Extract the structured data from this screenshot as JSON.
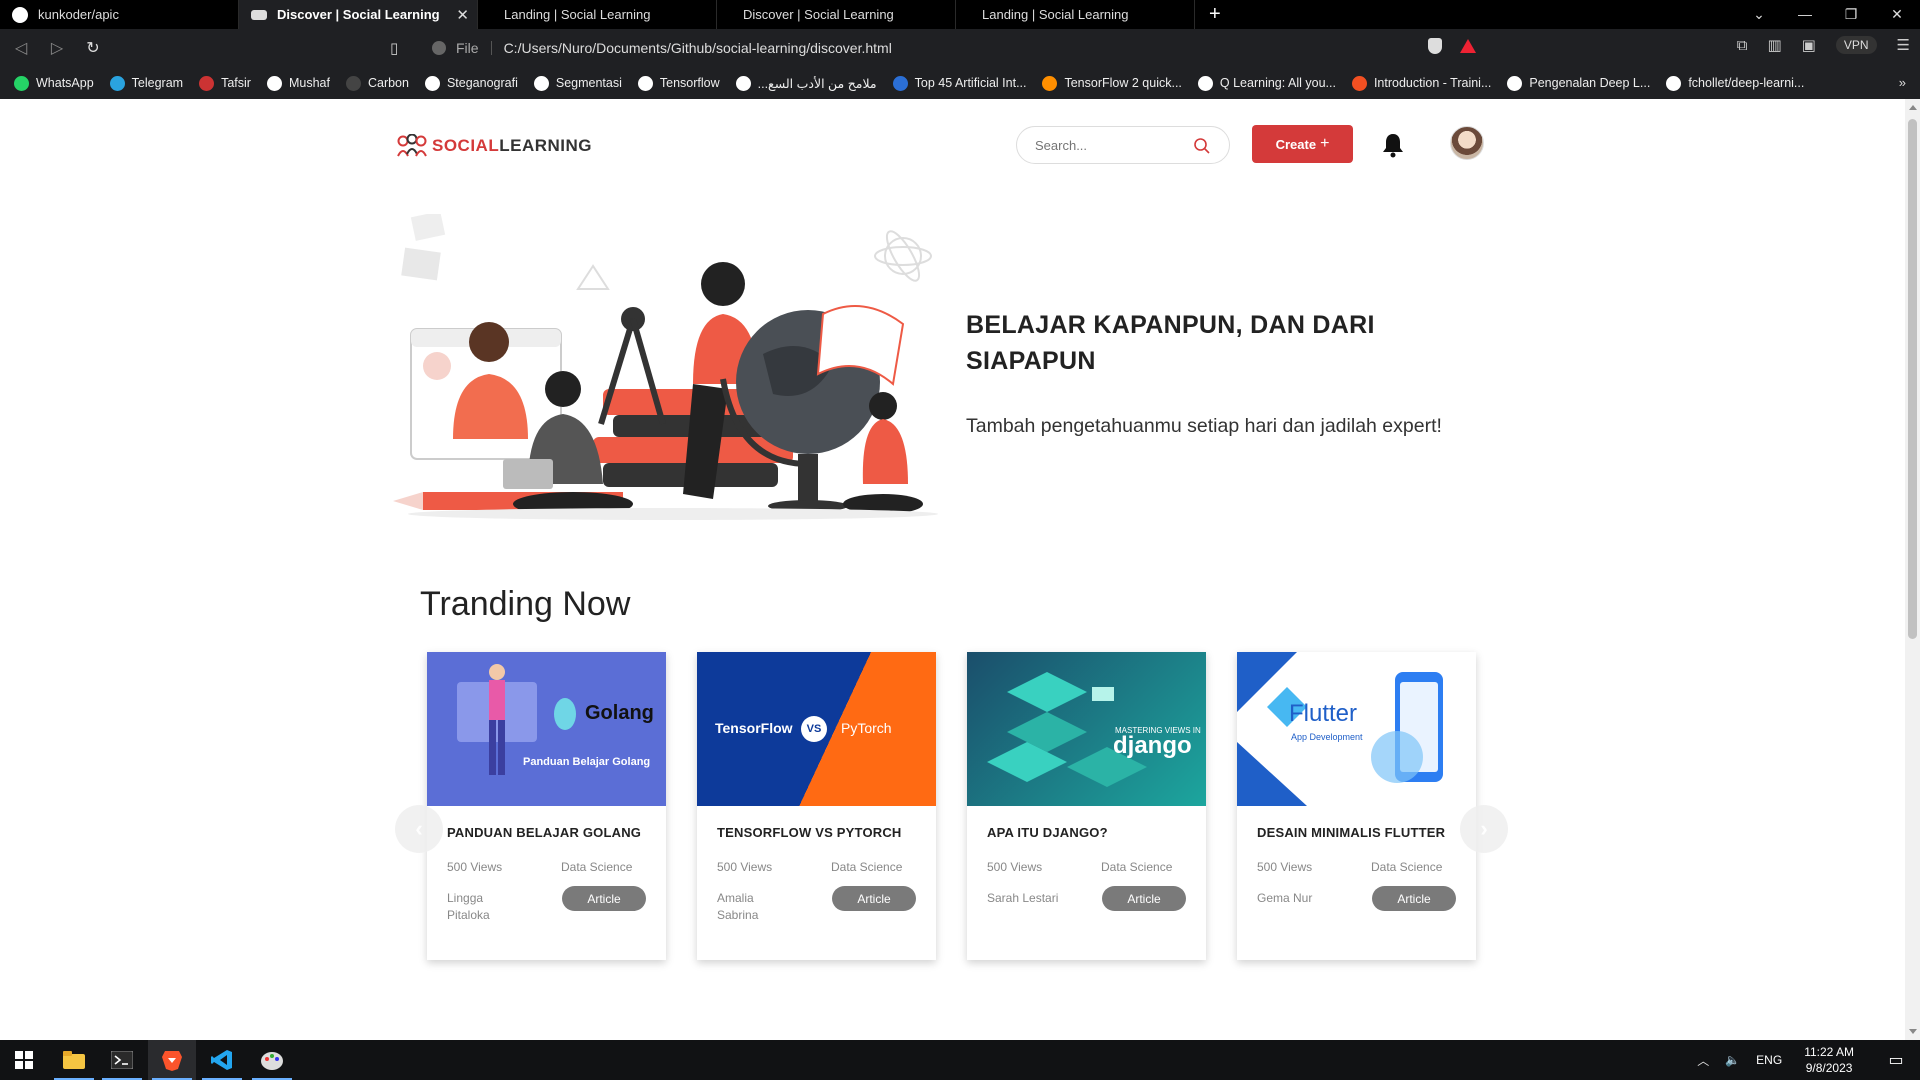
{
  "browser": {
    "tabs": [
      {
        "label": "kunkoder/apic",
        "active": false,
        "icon": "github-icon"
      },
      {
        "label": "Discover | Social Learning",
        "active": true,
        "icon": "mask-icon"
      },
      {
        "label": "Landing | Social Learning",
        "active": false,
        "icon": "blank"
      },
      {
        "label": "Discover | Social Learning",
        "active": false,
        "icon": "blank"
      },
      {
        "label": "Landing | Social Learning",
        "active": false,
        "icon": "blank"
      }
    ],
    "url_scheme": "File",
    "url": "C:/Users/Nuro/Documents/Github/social-learning/discover.html",
    "vpn_label": "VPN",
    "bookmarks": [
      {
        "label": "WhatsApp",
        "color": "#25d366"
      },
      {
        "label": "Telegram",
        "color": "#2aa3df"
      },
      {
        "label": "Tafsir",
        "color": "#c33"
      },
      {
        "label": "Mushaf",
        "color": "#ffffff"
      },
      {
        "label": "Carbon",
        "color": "#444444"
      },
      {
        "label": "Steganografi",
        "color": "#ffffff"
      },
      {
        "label": "Segmentasi",
        "color": "#ffffff"
      },
      {
        "label": "Tensorflow",
        "color": "#ffffff"
      },
      {
        "label": "...ملامح من الأدب السع",
        "color": "#ffffff"
      },
      {
        "label": "Top 45 Artificial Int...",
        "color": "#2b6fd6"
      },
      {
        "label": "TensorFlow 2 quick...",
        "color": "#ff8f00"
      },
      {
        "label": "Q Learning: All you...",
        "color": "#ffffff"
      },
      {
        "label": "Introduction - Traini...",
        "color": "#f25022"
      },
      {
        "label": "Pengenalan Deep L...",
        "color": "#ffffff"
      },
      {
        "label": "fchollet/deep-learni...",
        "color": "#ffffff"
      }
    ]
  },
  "site": {
    "logo_social": "SOCIAL",
    "logo_learning": "LEARNING",
    "search_placeholder": "Search...",
    "create_label": "Create",
    "hero_title": "BELAJAR KAPANPUN, DAN DARI SIAPAPUN",
    "hero_subtitle": "Tambah pengetahuanmu setiap hari dan jadilah expert!",
    "trending_title": "Tranding Now",
    "cards": [
      {
        "title": "PANDUAN BELAJAR GOLANG",
        "views": "500 Views",
        "category": "Data Science",
        "author": "Lingga Pitaloka",
        "badge": "Article",
        "thumb_caption": "Golang",
        "thumb_sub": "Panduan Belajar Golang"
      },
      {
        "title": "TENSORFLOW VS PYTORCH",
        "views": "500 Views",
        "category": "Data Science",
        "author": "Amalia Sabrina",
        "badge": "Article",
        "thumb_caption": "TensorFlow",
        "thumb_sub": "PyTorch"
      },
      {
        "title": "APA ITU DJANGO?",
        "views": "500 Views",
        "category": "Data Science",
        "author": "Sarah Lestari",
        "badge": "Article",
        "thumb_caption": "django",
        "thumb_sub": "MASTERING VIEWS IN"
      },
      {
        "title": "DESAIN MINIMALIS FLUTTER",
        "views": "500 Views",
        "category": "Data Science",
        "author": "Gema Nur",
        "badge": "Article",
        "thumb_caption": "Flutter",
        "thumb_sub": "App Development"
      }
    ]
  },
  "taskbar": {
    "language": "ENG",
    "time": "11:22 AM",
    "date": "9/8/2023"
  }
}
